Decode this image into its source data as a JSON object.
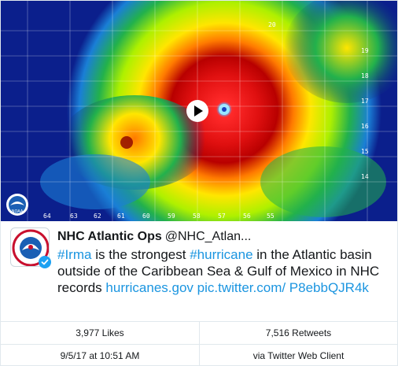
{
  "media": {
    "lon_labels": [
      "64",
      "63",
      "62",
      "61",
      "60",
      "59",
      "58",
      "57",
      "56",
      "55"
    ],
    "lat_labels": [
      "20",
      "19",
      "18",
      "17",
      "16",
      "15",
      "14"
    ],
    "logo_text": "NOAA",
    "play_icon": "play-icon"
  },
  "author": {
    "name": "NHC Atlantic Ops",
    "handle": "@NHC_Atlan...",
    "avatar_icon": "nws-avatar-icon",
    "verified_icon": "verified-badge-icon"
  },
  "tweet": {
    "hashtag_irma": "#Irma",
    "text_1": " is the strongest ",
    "hashtag_hurricane": "#hurricane",
    "text_2": " in the Atlantic basin outside of the Caribbean Sea & Gulf of Mexico in NHC records ",
    "link_site": "hurricanes.gov",
    "link_pic": " pic.twitter.com/ P8ebbQJR4k"
  },
  "stats": {
    "likes": "3,977 Likes",
    "retweets": "7,516 Retweets",
    "timestamp": "9/5/17 at 10:51 AM",
    "source": "via Twitter Web Client"
  },
  "colors": {
    "link": "#1b95e0",
    "border": "#e1e8ed"
  }
}
